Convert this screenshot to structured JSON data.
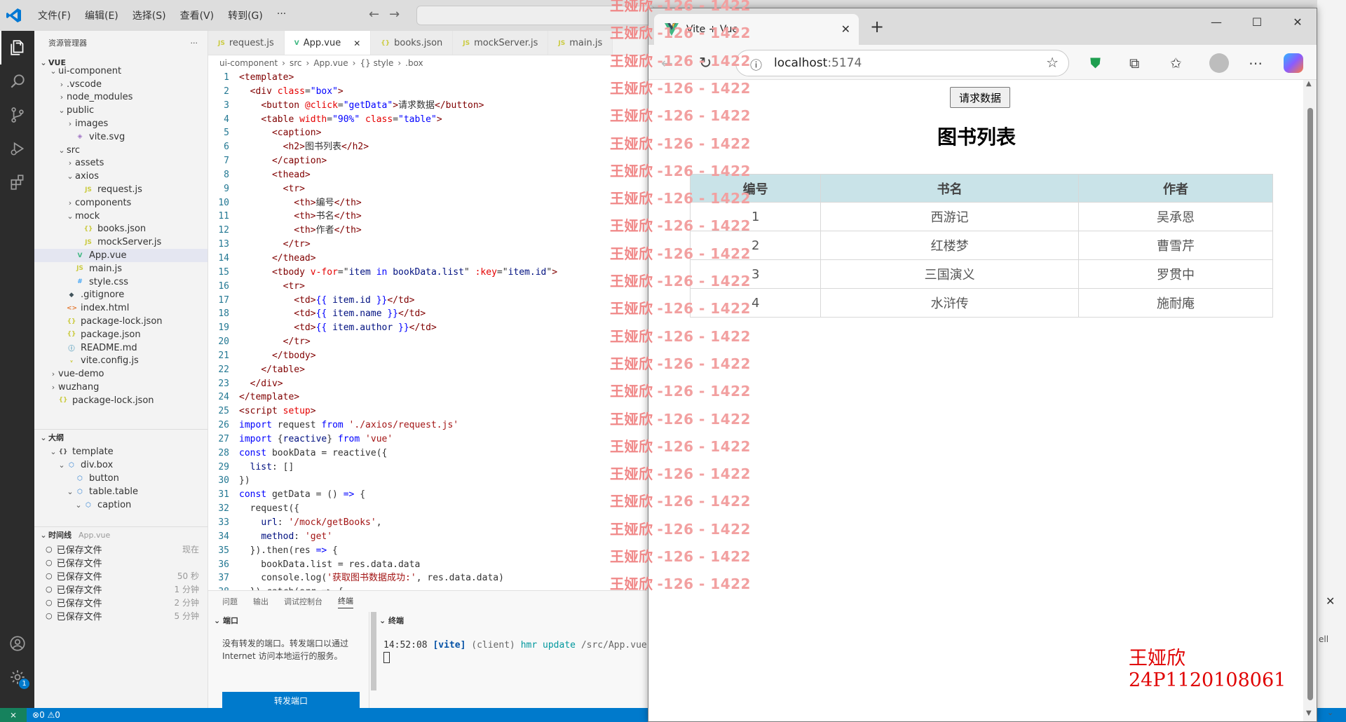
{
  "vscode": {
    "menu": [
      "文件(F)",
      "编辑(E)",
      "选择(S)",
      "查看(V)",
      "转到(G)",
      "···"
    ],
    "explorer_title": "资源管理器",
    "explorer_more": "···",
    "project": "VUE",
    "tree": [
      {
        "label": "ui-component",
        "indent": 1,
        "chev": "v",
        "icon": "",
        "color": ""
      },
      {
        "label": ".vscode",
        "indent": 2,
        "chev": ">",
        "icon": "",
        "color": ""
      },
      {
        "label": "node_modules",
        "indent": 2,
        "chev": ">",
        "icon": "",
        "color": ""
      },
      {
        "label": "public",
        "indent": 2,
        "chev": "v",
        "icon": "",
        "color": ""
      },
      {
        "label": "images",
        "indent": 3,
        "chev": ">",
        "icon": "",
        "color": ""
      },
      {
        "label": "vite.svg",
        "indent": 3,
        "chev": "",
        "icon": "◈",
        "color": "#a074c4"
      },
      {
        "label": "src",
        "indent": 2,
        "chev": "v",
        "icon": "",
        "color": ""
      },
      {
        "label": "assets",
        "indent": 3,
        "chev": ">",
        "icon": "",
        "color": ""
      },
      {
        "label": "axios",
        "indent": 3,
        "chev": "v",
        "icon": "",
        "color": ""
      },
      {
        "label": "request.js",
        "indent": 4,
        "chev": "",
        "icon": "JS",
        "color": "#cbcb41"
      },
      {
        "label": "components",
        "indent": 3,
        "chev": ">",
        "icon": "",
        "color": ""
      },
      {
        "label": "mock",
        "indent": 3,
        "chev": "v",
        "icon": "",
        "color": ""
      },
      {
        "label": "books.json",
        "indent": 4,
        "chev": "",
        "icon": "{}",
        "color": "#cbcb41"
      },
      {
        "label": "mockServer.js",
        "indent": 4,
        "chev": "",
        "icon": "JS",
        "color": "#cbcb41"
      },
      {
        "label": "App.vue",
        "indent": 3,
        "chev": "",
        "icon": "V",
        "color": "#41b883",
        "selected": true
      },
      {
        "label": "main.js",
        "indent": 3,
        "chev": "",
        "icon": "JS",
        "color": "#cbcb41"
      },
      {
        "label": "style.css",
        "indent": 3,
        "chev": "",
        "icon": "#",
        "color": "#42a5f5"
      },
      {
        "label": ".gitignore",
        "indent": 2,
        "chev": "",
        "icon": "◆",
        "color": "#41535b"
      },
      {
        "label": "index.html",
        "indent": 2,
        "chev": "",
        "icon": "<>",
        "color": "#e37933"
      },
      {
        "label": "package-lock.json",
        "indent": 2,
        "chev": "",
        "icon": "{}",
        "color": "#cbcb41"
      },
      {
        "label": "package.json",
        "indent": 2,
        "chev": "",
        "icon": "{}",
        "color": "#cbcb41"
      },
      {
        "label": "README.md",
        "indent": 2,
        "chev": "",
        "icon": "ⓘ",
        "color": "#519aba"
      },
      {
        "label": "vite.config.js",
        "indent": 2,
        "chev": "",
        "icon": "ᵥ",
        "color": "#cbcb41"
      },
      {
        "label": "vue-demo",
        "indent": 1,
        "chev": ">",
        "icon": "",
        "color": ""
      },
      {
        "label": "wuzhang",
        "indent": 1,
        "chev": ">",
        "icon": "",
        "color": ""
      },
      {
        "label": "package-lock.json",
        "indent": 1,
        "chev": "",
        "icon": "{}",
        "color": "#cbcb41"
      }
    ],
    "outline_title": "大纲",
    "outline": [
      {
        "label": "template",
        "indent": 1,
        "chev": "v",
        "icon": "{}",
        "color": "#555"
      },
      {
        "label": "div.box",
        "indent": 2,
        "chev": "v",
        "icon": "⬡",
        "color": "#2d7fd3"
      },
      {
        "label": "button",
        "indent": 3,
        "chev": "",
        "icon": "⬡",
        "color": "#2d7fd3"
      },
      {
        "label": "table.table",
        "indent": 3,
        "chev": "v",
        "icon": "⬡",
        "color": "#2d7fd3"
      },
      {
        "label": "caption",
        "indent": 4,
        "chev": "v",
        "icon": "⬡",
        "color": "#2d7fd3"
      }
    ],
    "timeline_title": "时间线",
    "timeline_file": "App.vue",
    "timeline": [
      {
        "label": "已保存文件",
        "time": "现在"
      },
      {
        "label": "已保存文件",
        "time": ""
      },
      {
        "label": "已保存文件",
        "time": "50 秒"
      },
      {
        "label": "已保存文件",
        "time": "1 分钟"
      },
      {
        "label": "已保存文件",
        "time": "2 分钟"
      },
      {
        "label": "已保存文件",
        "time": "5 分钟"
      }
    ],
    "tabs": [
      {
        "label": "request.js",
        "icon": "JS",
        "color": "#cbcb41",
        "active": false
      },
      {
        "label": "App.vue",
        "icon": "V",
        "color": "#41b883",
        "active": true
      },
      {
        "label": "books.json",
        "icon": "{}",
        "color": "#cbcb41",
        "active": false
      },
      {
        "label": "mockServer.js",
        "icon": "JS",
        "color": "#cbcb41",
        "active": false
      },
      {
        "label": "main.js",
        "icon": "JS",
        "color": "#cbcb41",
        "active": false
      }
    ],
    "breadcrumb": [
      "ui-component",
      "src",
      "App.vue",
      "{} style",
      ".box"
    ],
    "code": [
      [
        [
          "t",
          "<template>"
        ]
      ],
      [
        [
          "ct",
          "  "
        ],
        [
          "t",
          "<div "
        ],
        [
          "a",
          "class"
        ],
        [
          "ct",
          "="
        ],
        [
          "s",
          "\"box\""
        ],
        [
          "t",
          ">"
        ]
      ],
      [
        [
          "ct",
          "    "
        ],
        [
          "t",
          "<button "
        ],
        [
          "a",
          "@click"
        ],
        [
          "ct",
          "="
        ],
        [
          "s",
          "\"getData\""
        ],
        [
          "t",
          ">"
        ],
        [
          "ct",
          "请求数据"
        ],
        [
          "t",
          "</button>"
        ]
      ],
      [
        [
          "ct",
          "    "
        ],
        [
          "t",
          "<table "
        ],
        [
          "a",
          "width"
        ],
        [
          "ct",
          "="
        ],
        [
          "s",
          "\"90%\""
        ],
        [
          "a",
          " class"
        ],
        [
          "ct",
          "="
        ],
        [
          "s",
          "\"table\""
        ],
        [
          "t",
          ">"
        ]
      ],
      [
        [
          "ct",
          "      "
        ],
        [
          "t",
          "<caption>"
        ]
      ],
      [
        [
          "ct",
          "        "
        ],
        [
          "t",
          "<h2>"
        ],
        [
          "ct",
          "图书列表"
        ],
        [
          "t",
          "</h2>"
        ]
      ],
      [
        [
          "ct",
          "      "
        ],
        [
          "t",
          "</caption>"
        ]
      ],
      [
        [
          "ct",
          "      "
        ],
        [
          "t",
          "<thead>"
        ]
      ],
      [
        [
          "ct",
          "        "
        ],
        [
          "t",
          "<tr>"
        ]
      ],
      [
        [
          "ct",
          "          "
        ],
        [
          "t",
          "<th>"
        ],
        [
          "ct",
          "编号"
        ],
        [
          "t",
          "</th>"
        ]
      ],
      [
        [
          "ct",
          "          "
        ],
        [
          "t",
          "<th>"
        ],
        [
          "ct",
          "书名"
        ],
        [
          "t",
          "</th>"
        ]
      ],
      [
        [
          "ct",
          "          "
        ],
        [
          "t",
          "<th>"
        ],
        [
          "ct",
          "作者"
        ],
        [
          "t",
          "</th>"
        ]
      ],
      [
        [
          "ct",
          "        "
        ],
        [
          "t",
          "</tr>"
        ]
      ],
      [
        [
          "ct",
          "      "
        ],
        [
          "t",
          "</thead>"
        ]
      ],
      [
        [
          "ct",
          "      "
        ],
        [
          "t",
          "<tbody "
        ],
        [
          "a",
          "v-for"
        ],
        [
          "ct",
          "=\""
        ],
        [
          "b",
          "item"
        ],
        [
          "k",
          " in "
        ],
        [
          "b",
          "bookData.list"
        ],
        [
          "ct",
          "\" "
        ],
        [
          "a",
          ":key"
        ],
        [
          "ct",
          "=\""
        ],
        [
          "b",
          "item.id"
        ],
        [
          "ct",
          "\""
        ],
        [
          "t",
          ">"
        ]
      ],
      [
        [
          "ct",
          "        "
        ],
        [
          "t",
          "<tr>"
        ]
      ],
      [
        [
          "ct",
          "          "
        ],
        [
          "t",
          "<td>"
        ],
        [
          "s",
          "{{ "
        ],
        [
          "b",
          "item.id"
        ],
        [
          "s",
          " }}"
        ],
        [
          "t",
          "</td>"
        ]
      ],
      [
        [
          "ct",
          "          "
        ],
        [
          "t",
          "<td>"
        ],
        [
          "s",
          "{{ "
        ],
        [
          "b",
          "item.name"
        ],
        [
          "s",
          " }}"
        ],
        [
          "t",
          "</td>"
        ]
      ],
      [
        [
          "ct",
          "          "
        ],
        [
          "t",
          "<td>"
        ],
        [
          "s",
          "{{ "
        ],
        [
          "b",
          "item.author"
        ],
        [
          "s",
          " }}"
        ],
        [
          "t",
          "</td>"
        ]
      ],
      [
        [
          "ct",
          "        "
        ],
        [
          "t",
          "</tr>"
        ]
      ],
      [
        [
          "ct",
          "      "
        ],
        [
          "t",
          "</tbody>"
        ]
      ],
      [
        [
          "ct",
          "    "
        ],
        [
          "t",
          "</table>"
        ]
      ],
      [
        [
          "ct",
          "  "
        ],
        [
          "t",
          "</div>"
        ]
      ],
      [
        [
          "t",
          "</template>"
        ]
      ],
      [
        [
          "t",
          "<script "
        ],
        [
          "a",
          "setup"
        ],
        [
          "t",
          ">"
        ]
      ],
      [
        [
          "k",
          "import"
        ],
        [
          "ct",
          " request "
        ],
        [
          "k",
          "from"
        ],
        [
          "str",
          " './axios/request.js'"
        ]
      ],
      [
        [
          "k",
          "import"
        ],
        [
          "ct",
          " {"
        ],
        [
          "b",
          "reactive"
        ],
        [
          "ct",
          "} "
        ],
        [
          "k",
          "from"
        ],
        [
          "str",
          " 'vue'"
        ]
      ],
      [
        [
          "k",
          "const"
        ],
        [
          "ct",
          " bookData = "
        ],
        [
          "ct",
          "reactive"
        ],
        [
          "ct",
          "({"
        ]
      ],
      [
        [
          "ct",
          "  "
        ],
        [
          "b",
          "list"
        ],
        [
          "ct",
          ": []"
        ]
      ],
      [
        [
          "ct",
          "})"
        ]
      ],
      [
        [
          "k",
          "const"
        ],
        [
          "ct",
          " getData = () "
        ],
        [
          "k",
          "=>"
        ],
        [
          "ct",
          " {"
        ]
      ],
      [
        [
          "ct",
          "  request({"
        ]
      ],
      [
        [
          "ct",
          "    "
        ],
        [
          "b",
          "url"
        ],
        [
          "ct",
          ": "
        ],
        [
          "str",
          "'/mock/getBooks'"
        ],
        [
          "ct",
          ","
        ]
      ],
      [
        [
          "ct",
          "    "
        ],
        [
          "b",
          "method"
        ],
        [
          "ct",
          ": "
        ],
        [
          "str",
          "'get'"
        ]
      ],
      [
        [
          "ct",
          "  }).then(res "
        ],
        [
          "k",
          "=>"
        ],
        [
          "ct",
          " {"
        ]
      ],
      [
        [
          "ct",
          "    bookData.list = res.data.data"
        ]
      ],
      [
        [
          "ct",
          "    console.log("
        ],
        [
          "str",
          "'获取图书数据成功:'"
        ],
        [
          "ct",
          ", res.data.data)"
        ]
      ],
      [
        [
          "ct",
          "  }).catch(err => {"
        ]
      ]
    ],
    "panel_tabs": [
      "问题",
      "输出",
      "调试控制台",
      "终端"
    ],
    "ports_title": "端口",
    "ports_text": "没有转发的端口。转发端口以通过 Internet 访问本地运行的服务。",
    "forward_button": "转发端口",
    "terminal_title": "终端",
    "terminal_time": "14:52:08",
    "terminal_tag": "[vite]",
    "terminal_client": "(client)",
    "terminal_msg": "hmr update",
    "terminal_path": "/src/App.vue",
    "status_errors": "0",
    "status_warnings": "0",
    "settings_badge": "1",
    "accent": "#007acc"
  },
  "browser": {
    "tab_title": "Vite + Vue",
    "address_host": "localhost",
    "address_port": ":5174",
    "request_button": "请求数据",
    "table_title": "图书列表",
    "headers": [
      "编号",
      "书名",
      "作者"
    ],
    "rows": [
      [
        "1",
        "西游记",
        "吴承恩"
      ],
      [
        "2",
        "红楼梦",
        "曹雪芹"
      ],
      [
        "3",
        "三国演义",
        "罗贯中"
      ],
      [
        "4",
        "水浒传",
        "施耐庵"
      ]
    ]
  },
  "watermark": {
    "name": "王娅欣",
    "code": "-126 - 1422",
    "signature_name": "王娅欣",
    "signature_id": "24P1120108061"
  },
  "right_strip": {
    "partial_text": "ell"
  }
}
